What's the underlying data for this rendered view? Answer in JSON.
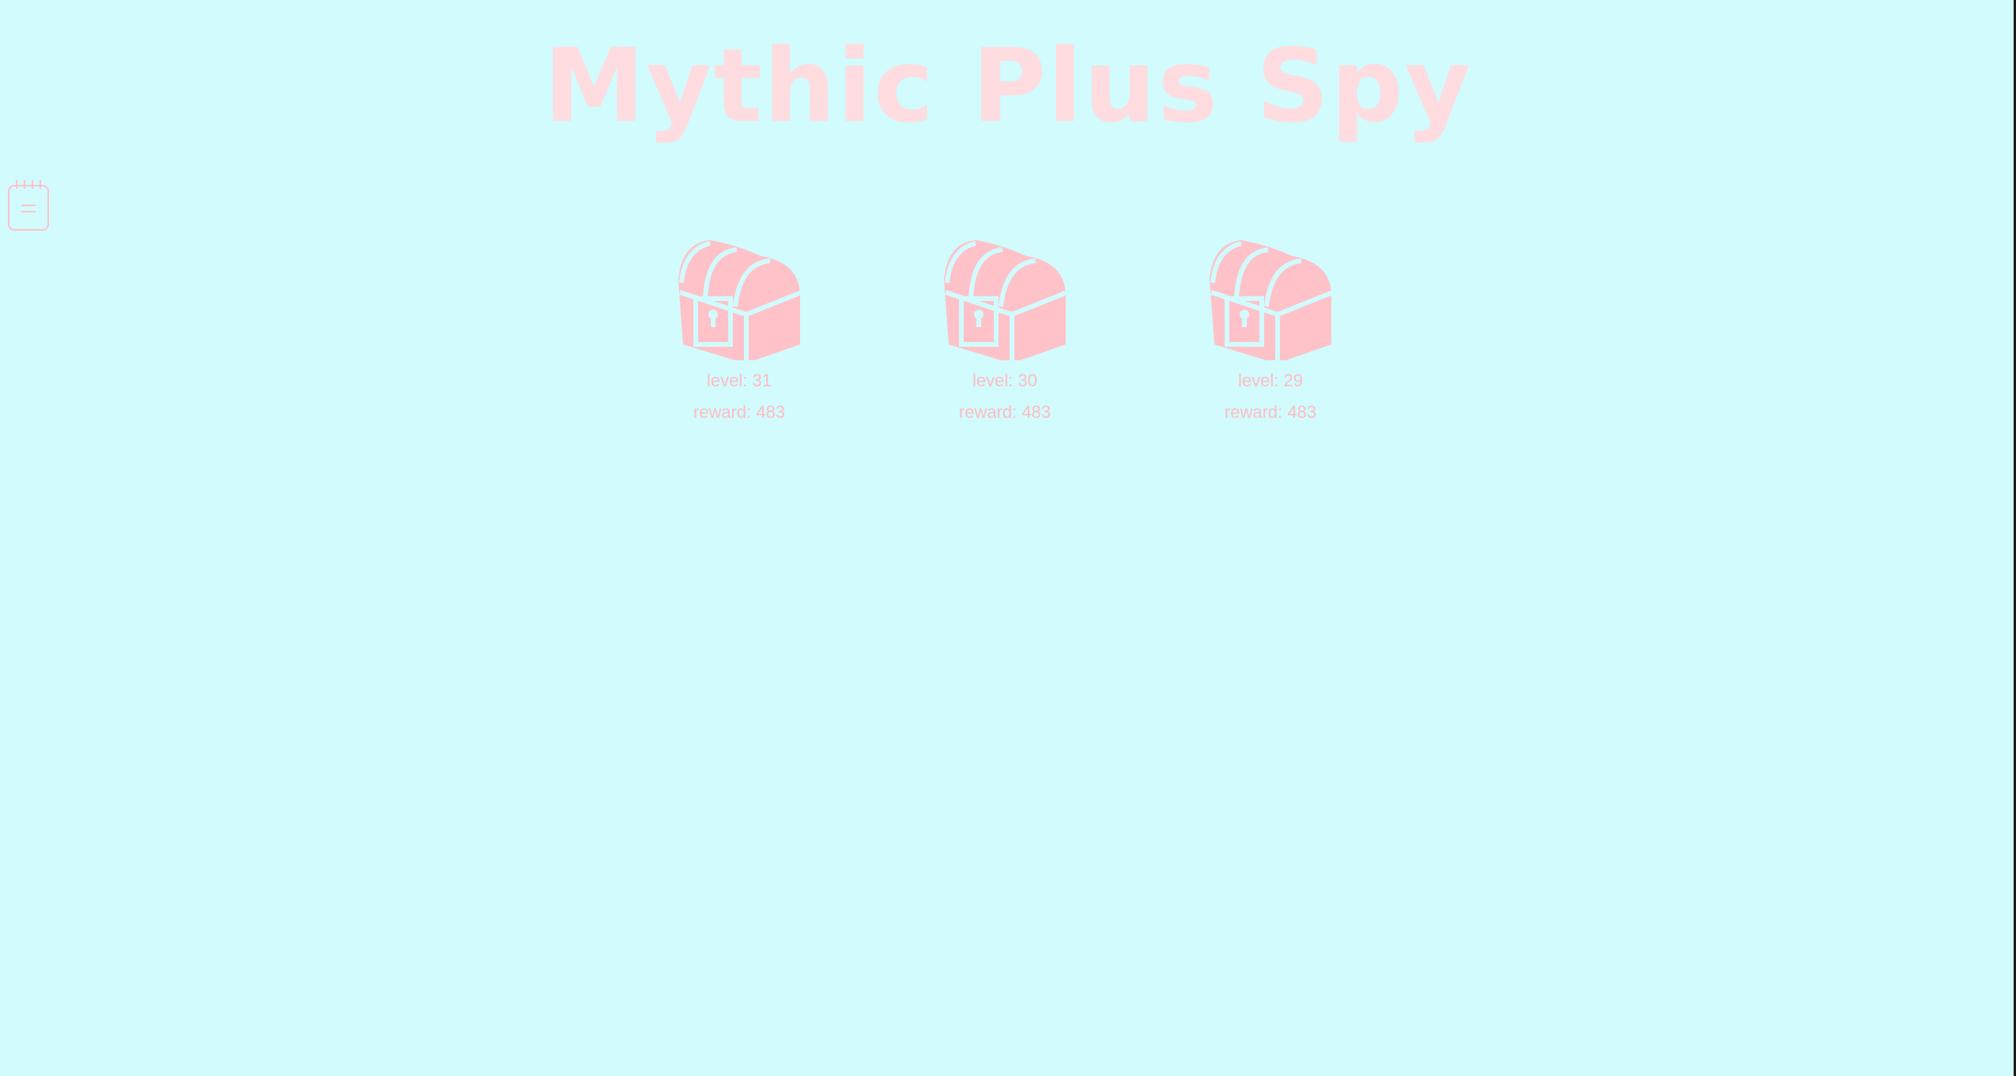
{
  "app": {
    "title": "Mythic Plus Spy"
  },
  "sidebar": {
    "notes_icon": "notepad-icon"
  },
  "chests": [
    {
      "icon": "treasure-chest-icon",
      "level": "level: 31",
      "reward": "reward: 483"
    },
    {
      "icon": "treasure-chest-icon",
      "level": "level: 30",
      "reward": "reward: 483"
    },
    {
      "icon": "treasure-chest-icon",
      "level": "level: 29",
      "reward": "reward: 483"
    }
  ],
  "colors": {
    "background": "#d1fbfd",
    "title": "#ffdcdf",
    "accent": "#ffc2c8",
    "text": "#ffbcc3"
  }
}
